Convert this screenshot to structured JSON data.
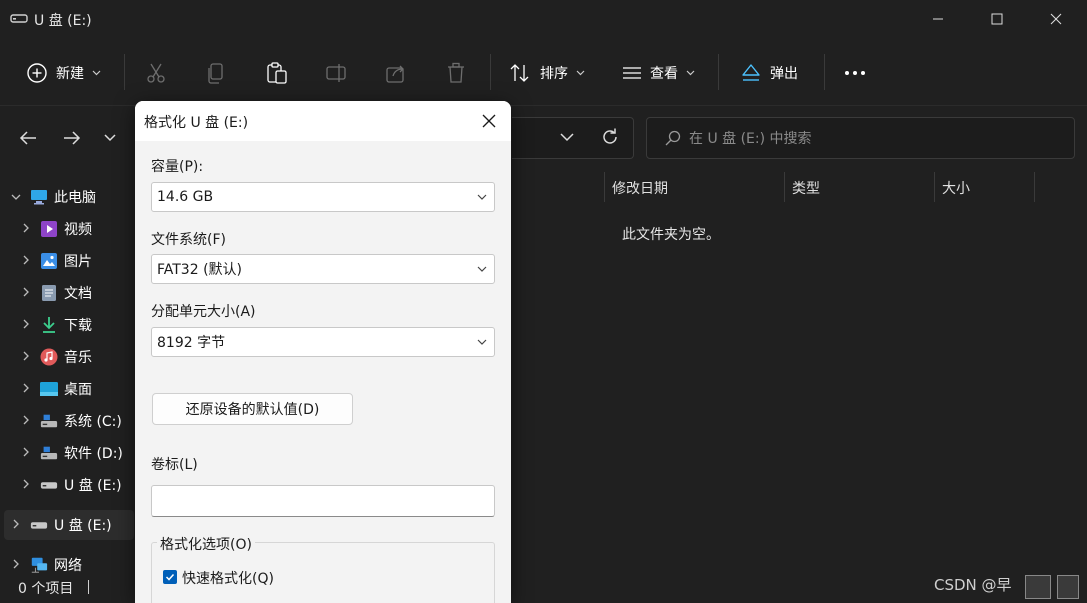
{
  "window": {
    "title": "U 盘 (E:)"
  },
  "toolbar": {
    "new_label": "新建",
    "sort_label": "排序",
    "view_label": "查看",
    "eject_label": "弹出"
  },
  "search": {
    "placeholder": "在 U 盘 (E:) 中搜索"
  },
  "sidebar": {
    "items": [
      {
        "label": "此电脑",
        "icon": "pc-icon"
      },
      {
        "label": "视频",
        "icon": "video-icon"
      },
      {
        "label": "图片",
        "icon": "pictures-icon"
      },
      {
        "label": "文档",
        "icon": "documents-icon"
      },
      {
        "label": "下载",
        "icon": "download-icon"
      },
      {
        "label": "音乐",
        "icon": "music-icon"
      },
      {
        "label": "桌面",
        "icon": "desktop-icon"
      },
      {
        "label": "系统 (C:)",
        "icon": "drive-icon"
      },
      {
        "label": "软件 (D:)",
        "icon": "drive-icon"
      },
      {
        "label": "U 盘 (E:)",
        "icon": "usb-drive-icon"
      },
      {
        "label": "U 盘 (E:)",
        "icon": "usb-drive-icon"
      },
      {
        "label": "网络",
        "icon": "network-icon"
      }
    ]
  },
  "columns": {
    "modified": "修改日期",
    "type": "类型",
    "size": "大小"
  },
  "content": {
    "empty_message": "此文件夹为空。"
  },
  "status": {
    "item_count": "0 个项目"
  },
  "watermark": {
    "text": "CSDN @早"
  },
  "dialog": {
    "title": "格式化 U 盘 (E:)",
    "capacity_label": "容量(P):",
    "capacity_value": "14.6 GB",
    "fs_label": "文件系统(F)",
    "fs_value": "FAT32 (默认)",
    "alloc_label": "分配单元大小(A)",
    "alloc_value": "8192 字节",
    "restore_button": "还原设备的默认值(D)",
    "volume_label": "卷标(L)",
    "volume_value": "",
    "options_label": "格式化选项(O)",
    "quick_format_label": "快速格式化(Q)",
    "quick_format_checked": true
  },
  "colors": {
    "background": "#202020",
    "dialog_bg": "#f3f3f3",
    "accent": "#005fb8"
  }
}
